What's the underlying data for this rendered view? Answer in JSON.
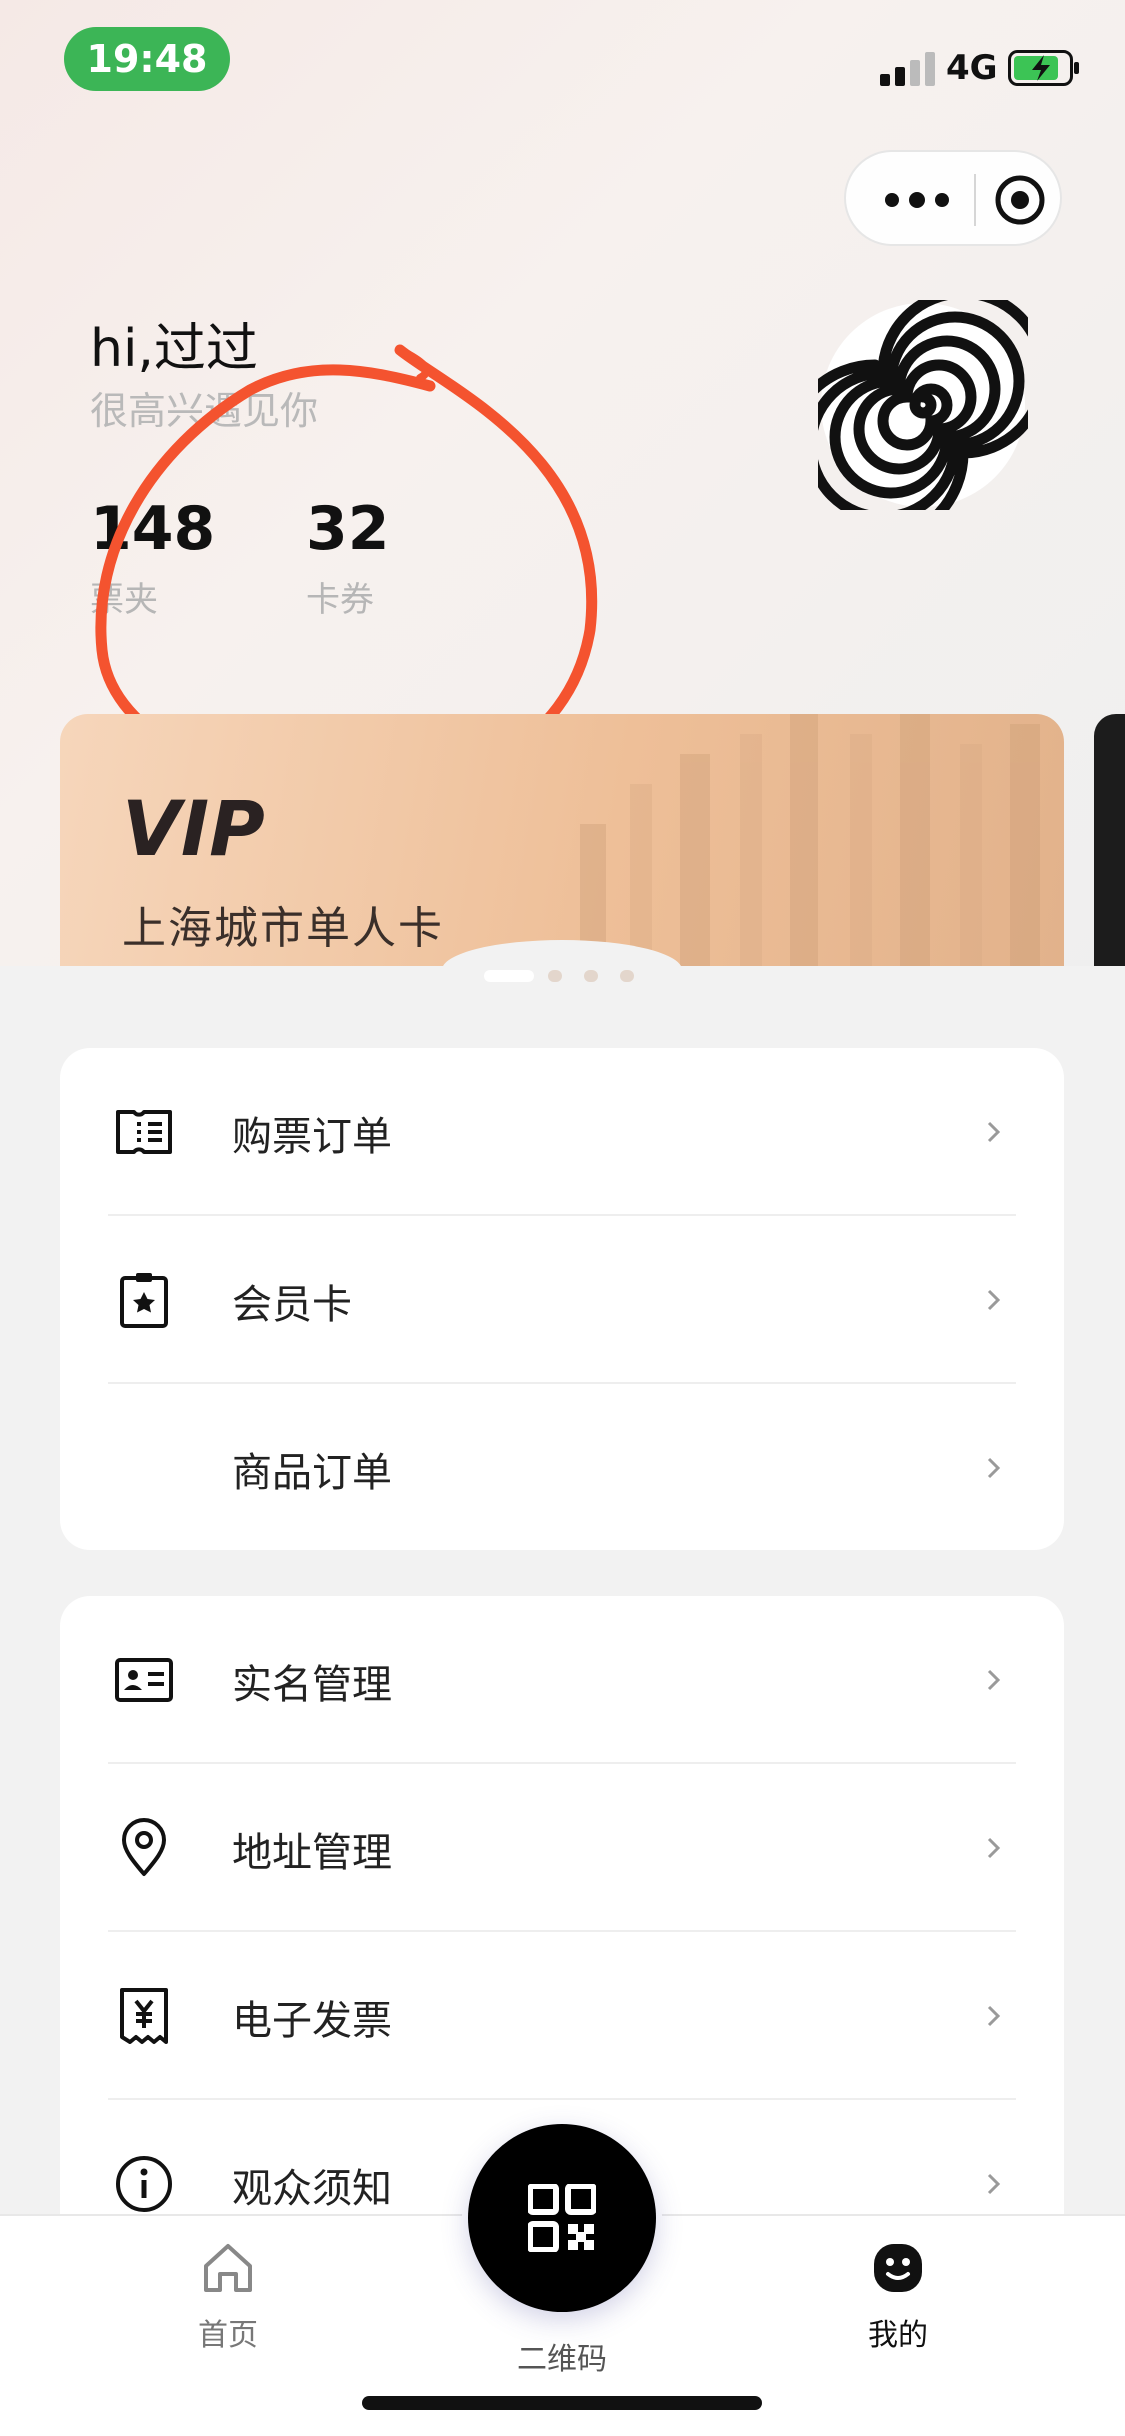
{
  "status_bar": {
    "time": "19:48",
    "network": "4G"
  },
  "profile": {
    "greeting": "hi,过过",
    "subtitle": "很高兴遇见你",
    "stats": [
      {
        "value": "148",
        "label": "票夹"
      },
      {
        "value": "32",
        "label": "卡券"
      }
    ]
  },
  "vip_card": {
    "title": "VIP",
    "name": "上海城市单人卡"
  },
  "carousel": {
    "pages": 4,
    "active_index": 0
  },
  "menu_group_1": [
    {
      "label": "购票订单",
      "icon": "ticket-icon"
    },
    {
      "label": "会员卡",
      "icon": "member-card-icon"
    },
    {
      "label": "商品订单",
      "icon": "none"
    }
  ],
  "menu_group_2": [
    {
      "label": "实名管理",
      "icon": "id-card-icon"
    },
    {
      "label": "地址管理",
      "icon": "location-pin-icon"
    },
    {
      "label": "电子发票",
      "icon": "invoice-icon"
    },
    {
      "label": "观众须知",
      "icon": "info-icon"
    }
  ],
  "tab_bar": {
    "home": "首页",
    "qr": "二维码",
    "mine": "我的",
    "active": "mine"
  },
  "colors": {
    "time_pill": "#3cb556",
    "annotation_circle": "#f4532f",
    "vip_gradient_start": "#f6d6bb",
    "vip_gradient_end": "#e2b28b"
  }
}
